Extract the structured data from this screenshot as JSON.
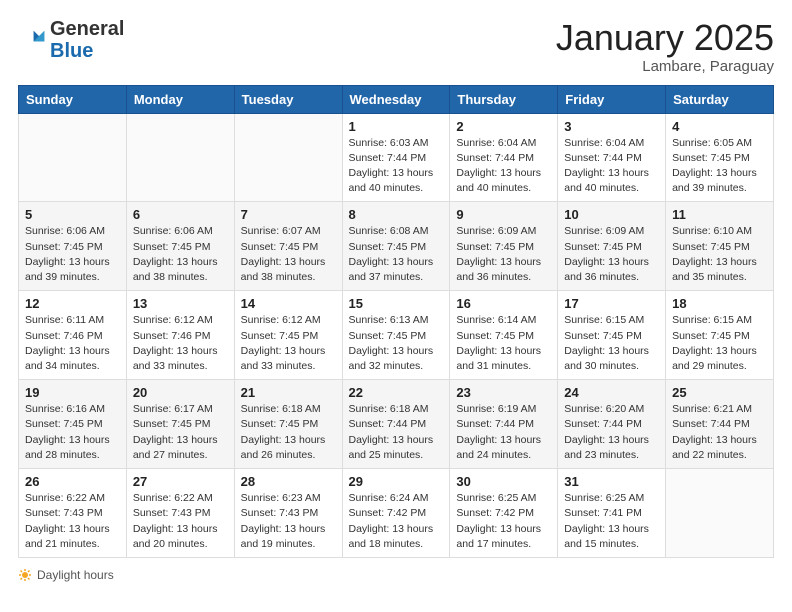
{
  "header": {
    "logo_general": "General",
    "logo_blue": "Blue",
    "month_title": "January 2025",
    "location": "Lambare, Paraguay"
  },
  "footer": {
    "daylight_label": "Daylight hours"
  },
  "weekdays": [
    "Sunday",
    "Monday",
    "Tuesday",
    "Wednesday",
    "Thursday",
    "Friday",
    "Saturday"
  ],
  "weeks": [
    [
      {
        "num": "",
        "info": ""
      },
      {
        "num": "",
        "info": ""
      },
      {
        "num": "",
        "info": ""
      },
      {
        "num": "1",
        "info": "Sunrise: 6:03 AM\nSunset: 7:44 PM\nDaylight: 13 hours\nand 40 minutes."
      },
      {
        "num": "2",
        "info": "Sunrise: 6:04 AM\nSunset: 7:44 PM\nDaylight: 13 hours\nand 40 minutes."
      },
      {
        "num": "3",
        "info": "Sunrise: 6:04 AM\nSunset: 7:44 PM\nDaylight: 13 hours\nand 40 minutes."
      },
      {
        "num": "4",
        "info": "Sunrise: 6:05 AM\nSunset: 7:45 PM\nDaylight: 13 hours\nand 39 minutes."
      }
    ],
    [
      {
        "num": "5",
        "info": "Sunrise: 6:06 AM\nSunset: 7:45 PM\nDaylight: 13 hours\nand 39 minutes."
      },
      {
        "num": "6",
        "info": "Sunrise: 6:06 AM\nSunset: 7:45 PM\nDaylight: 13 hours\nand 38 minutes."
      },
      {
        "num": "7",
        "info": "Sunrise: 6:07 AM\nSunset: 7:45 PM\nDaylight: 13 hours\nand 38 minutes."
      },
      {
        "num": "8",
        "info": "Sunrise: 6:08 AM\nSunset: 7:45 PM\nDaylight: 13 hours\nand 37 minutes."
      },
      {
        "num": "9",
        "info": "Sunrise: 6:09 AM\nSunset: 7:45 PM\nDaylight: 13 hours\nand 36 minutes."
      },
      {
        "num": "10",
        "info": "Sunrise: 6:09 AM\nSunset: 7:45 PM\nDaylight: 13 hours\nand 36 minutes."
      },
      {
        "num": "11",
        "info": "Sunrise: 6:10 AM\nSunset: 7:45 PM\nDaylight: 13 hours\nand 35 minutes."
      }
    ],
    [
      {
        "num": "12",
        "info": "Sunrise: 6:11 AM\nSunset: 7:46 PM\nDaylight: 13 hours\nand 34 minutes."
      },
      {
        "num": "13",
        "info": "Sunrise: 6:12 AM\nSunset: 7:46 PM\nDaylight: 13 hours\nand 33 minutes."
      },
      {
        "num": "14",
        "info": "Sunrise: 6:12 AM\nSunset: 7:45 PM\nDaylight: 13 hours\nand 33 minutes."
      },
      {
        "num": "15",
        "info": "Sunrise: 6:13 AM\nSunset: 7:45 PM\nDaylight: 13 hours\nand 32 minutes."
      },
      {
        "num": "16",
        "info": "Sunrise: 6:14 AM\nSunset: 7:45 PM\nDaylight: 13 hours\nand 31 minutes."
      },
      {
        "num": "17",
        "info": "Sunrise: 6:15 AM\nSunset: 7:45 PM\nDaylight: 13 hours\nand 30 minutes."
      },
      {
        "num": "18",
        "info": "Sunrise: 6:15 AM\nSunset: 7:45 PM\nDaylight: 13 hours\nand 29 minutes."
      }
    ],
    [
      {
        "num": "19",
        "info": "Sunrise: 6:16 AM\nSunset: 7:45 PM\nDaylight: 13 hours\nand 28 minutes."
      },
      {
        "num": "20",
        "info": "Sunrise: 6:17 AM\nSunset: 7:45 PM\nDaylight: 13 hours\nand 27 minutes."
      },
      {
        "num": "21",
        "info": "Sunrise: 6:18 AM\nSunset: 7:45 PM\nDaylight: 13 hours\nand 26 minutes."
      },
      {
        "num": "22",
        "info": "Sunrise: 6:18 AM\nSunset: 7:44 PM\nDaylight: 13 hours\nand 25 minutes."
      },
      {
        "num": "23",
        "info": "Sunrise: 6:19 AM\nSunset: 7:44 PM\nDaylight: 13 hours\nand 24 minutes."
      },
      {
        "num": "24",
        "info": "Sunrise: 6:20 AM\nSunset: 7:44 PM\nDaylight: 13 hours\nand 23 minutes."
      },
      {
        "num": "25",
        "info": "Sunrise: 6:21 AM\nSunset: 7:44 PM\nDaylight: 13 hours\nand 22 minutes."
      }
    ],
    [
      {
        "num": "26",
        "info": "Sunrise: 6:22 AM\nSunset: 7:43 PM\nDaylight: 13 hours\nand 21 minutes."
      },
      {
        "num": "27",
        "info": "Sunrise: 6:22 AM\nSunset: 7:43 PM\nDaylight: 13 hours\nand 20 minutes."
      },
      {
        "num": "28",
        "info": "Sunrise: 6:23 AM\nSunset: 7:43 PM\nDaylight: 13 hours\nand 19 minutes."
      },
      {
        "num": "29",
        "info": "Sunrise: 6:24 AM\nSunset: 7:42 PM\nDaylight: 13 hours\nand 18 minutes."
      },
      {
        "num": "30",
        "info": "Sunrise: 6:25 AM\nSunset: 7:42 PM\nDaylight: 13 hours\nand 17 minutes."
      },
      {
        "num": "31",
        "info": "Sunrise: 6:25 AM\nSunset: 7:41 PM\nDaylight: 13 hours\nand 15 minutes."
      },
      {
        "num": "",
        "info": ""
      }
    ]
  ]
}
